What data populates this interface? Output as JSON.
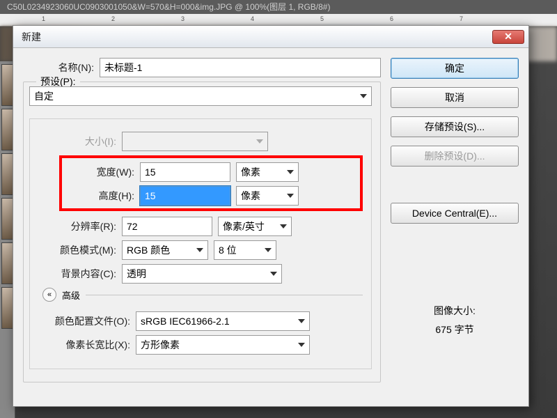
{
  "ps_tab_title": "C50L0234923060UC0903001050&W=570&H=000&img.JPG @ 100%(图层 1, RGB/8#)",
  "ruler_marks": [
    "1",
    "2",
    "3",
    "4",
    "5",
    "6",
    "7"
  ],
  "dialog": {
    "title": "新建",
    "close_glyph": "✕",
    "name": {
      "label": "名称(N):",
      "value": "未标题-1"
    },
    "preset_legend": "预设(P):",
    "preset_value": "自定",
    "size": {
      "label": "大小(I):",
      "value": ""
    },
    "width": {
      "label": "宽度(W):",
      "value": "15",
      "unit": "像素"
    },
    "height": {
      "label": "高度(H):",
      "value": "15",
      "unit": "像素"
    },
    "resolution": {
      "label": "分辨率(R):",
      "value": "72",
      "unit": "像素/英寸"
    },
    "color_mode": {
      "label": "颜色模式(M):",
      "mode": "RGB 颜色",
      "depth": "8 位"
    },
    "bg": {
      "label": "背景内容(C):",
      "value": "透明"
    },
    "advanced": "高级",
    "profile": {
      "label": "颜色配置文件(O):",
      "value": "sRGB IEC61966-2.1"
    },
    "aspect": {
      "label": "像素长宽比(X):",
      "value": "方形像素"
    }
  },
  "buttons": {
    "ok": "确定",
    "cancel": "取消",
    "save_preset": "存储预设(S)...",
    "delete_preset": "删除预设(D)...",
    "device_central": "Device Central(E)..."
  },
  "image_size": {
    "label": "图像大小:",
    "value": "675 字节"
  }
}
